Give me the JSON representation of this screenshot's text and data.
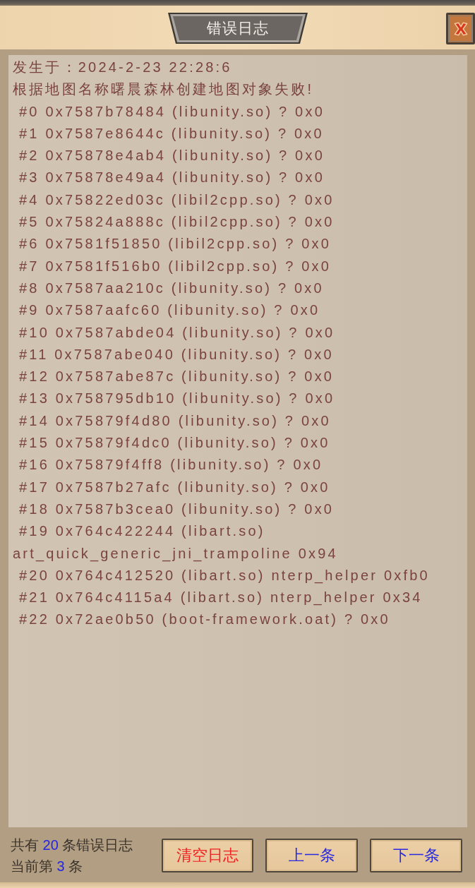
{
  "window": {
    "title": "错误日志"
  },
  "log": {
    "lines": [
      {
        "kind": "plain",
        "text": "发生于：2024-2-23 22:28:6"
      },
      {
        "kind": "plain",
        "text": "根据地图名称曙晨森林创建地图对象失败!"
      },
      {
        "kind": "frame",
        "text": "#0 0x7587b78484 (libunity.so) ? 0x0"
      },
      {
        "kind": "frame",
        "text": "#1 0x7587e8644c (libunity.so) ? 0x0"
      },
      {
        "kind": "frame",
        "text": "#2 0x75878e4ab4 (libunity.so) ? 0x0"
      },
      {
        "kind": "frame",
        "text": "#3 0x75878e49a4 (libunity.so) ? 0x0"
      },
      {
        "kind": "frame",
        "text": "#4 0x75822ed03c (libil2cpp.so) ? 0x0"
      },
      {
        "kind": "frame",
        "text": "#5 0x75824a888c (libil2cpp.so) ? 0x0"
      },
      {
        "kind": "frame",
        "text": "#6 0x7581f51850 (libil2cpp.so) ? 0x0"
      },
      {
        "kind": "frame",
        "text": "#7 0x7581f516b0 (libil2cpp.so) ? 0x0"
      },
      {
        "kind": "frame",
        "text": "#8 0x7587aa210c (libunity.so) ? 0x0"
      },
      {
        "kind": "frame",
        "text": "#9 0x7587aafc60 (libunity.so) ? 0x0"
      },
      {
        "kind": "frame",
        "text": "#10 0x7587abde04 (libunity.so) ? 0x0"
      },
      {
        "kind": "frame",
        "text": "#11 0x7587abe040 (libunity.so) ? 0x0"
      },
      {
        "kind": "frame",
        "text": "#12 0x7587abe87c (libunity.so) ? 0x0"
      },
      {
        "kind": "frame",
        "text": "#13 0x758795db10 (libunity.so) ? 0x0"
      },
      {
        "kind": "frame",
        "text": "#14 0x75879f4d80 (libunity.so) ? 0x0"
      },
      {
        "kind": "frame",
        "text": "#15 0x75879f4dc0 (libunity.so) ? 0x0"
      },
      {
        "kind": "frame",
        "text": "#16 0x75879f4ff8 (libunity.so) ? 0x0"
      },
      {
        "kind": "frame",
        "text": "#17 0x7587b27afc (libunity.so) ? 0x0"
      },
      {
        "kind": "frame",
        "text": "#18 0x7587b3cea0 (libunity.so) ? 0x0"
      },
      {
        "kind": "frame",
        "text": "#19 0x764c422244 (libart.so)"
      },
      {
        "kind": "plain",
        "text": "art_quick_generic_jni_trampoline 0x94"
      },
      {
        "kind": "frame",
        "text": "#20 0x764c412520 (libart.so) nterp_helper 0xfb0"
      },
      {
        "kind": "frame",
        "text": "#21 0x764c4115a4 (libart.so) nterp_helper 0x34"
      },
      {
        "kind": "frame",
        "text": "#22 0x72ae0b50 (boot-framework.oat) ? 0x0"
      }
    ]
  },
  "footer": {
    "total": {
      "before": "共有",
      "count": "20",
      "after": "条错误日志"
    },
    "current": {
      "before": "当前第",
      "count": "3",
      "after": "条"
    }
  },
  "buttons": [
    {
      "label": "清空日志",
      "kind": "danger"
    },
    {
      "label": "上一条",
      "kind": "nav"
    },
    {
      "label": "下一条",
      "kind": "nav"
    }
  ]
}
